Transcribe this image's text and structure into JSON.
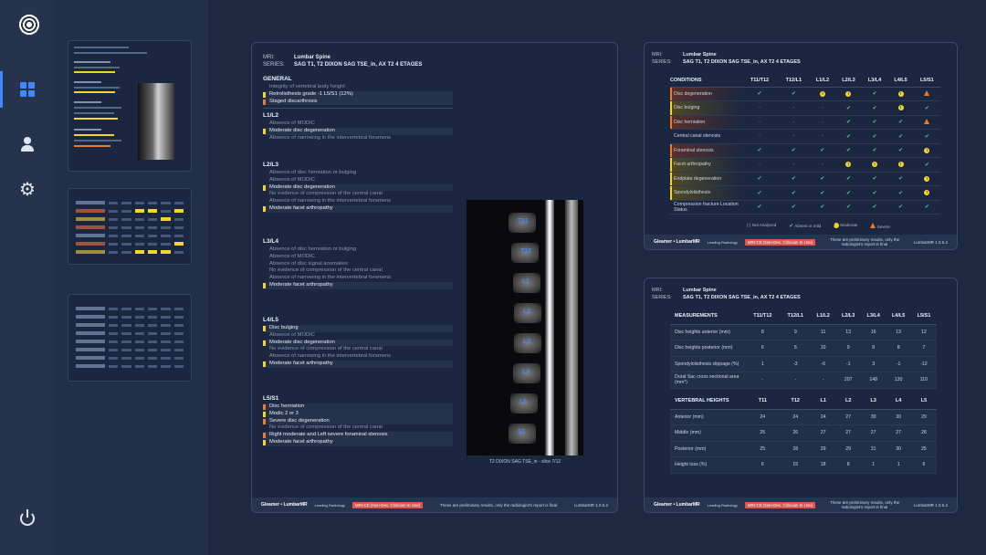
{
  "nav": {
    "items": [
      "dashboard",
      "user",
      "settings",
      "power"
    ]
  },
  "report": {
    "mri_label": "MRI:",
    "mri_value": "Lumbar Spine",
    "series_label": "SERIES:",
    "series_value": "SAG T1, T2 DIXON SAG TSE_in, AX T2 4 ETAGES",
    "image_caption": "T2 DIXON SAG TSE_in - slice 7/12",
    "image_labels": [
      "T11",
      "T12",
      "L1",
      "L2",
      "L3",
      "L4",
      "L5",
      "S1"
    ],
    "sections": [
      {
        "title": "GENERAL",
        "lines": [
          {
            "text": "Integrity of vertebral body height",
            "flag": ""
          },
          {
            "text": "Retrolisthesis grade -1 L5/S1 (12%)",
            "flag": "#f4d52b"
          },
          {
            "text": "Staged discarthrosis",
            "flag": "#f07a2b"
          }
        ]
      },
      {
        "title": "L1/L2",
        "lines": [
          {
            "text": "Absence of MODIC",
            "flag": ""
          },
          {
            "text": "Moderate disc degeneration",
            "flag": "#f4d52b"
          },
          {
            "text": "Absence of narrowing in the intervertebral foramens",
            "flag": ""
          }
        ]
      },
      {
        "title": "L2/L3",
        "lines": [
          {
            "text": "Absence of disc herniation or bulging",
            "flag": ""
          },
          {
            "text": "Absence of MODIC",
            "flag": ""
          },
          {
            "text": "Moderate disc degeneration",
            "flag": "#f4d52b"
          },
          {
            "text": "No evidence of compression of the central canal",
            "flag": ""
          },
          {
            "text": "Absence of narrowing in the intervertebral foramens",
            "flag": ""
          },
          {
            "text": "Moderate facet arthropathy",
            "flag": "#f4d52b"
          }
        ]
      },
      {
        "title": "L3/L4",
        "lines": [
          {
            "text": "Absence of disc herniation or bulging",
            "flag": ""
          },
          {
            "text": "Absence of MODIC",
            "flag": ""
          },
          {
            "text": "Absence of disc signal anomalies",
            "flag": ""
          },
          {
            "text": "No evidence of compression of the central canal",
            "flag": ""
          },
          {
            "text": "Absence of narrowing in the intervertebral foramens",
            "flag": ""
          },
          {
            "text": "Moderate facet arthropathy",
            "flag": "#f4d52b"
          }
        ]
      },
      {
        "title": "L4/L5",
        "lines": [
          {
            "text": "Disc bulging",
            "flag": "#f4d52b"
          },
          {
            "text": "Absence of MODIC",
            "flag": ""
          },
          {
            "text": "Moderate disc degeneration",
            "flag": "#f4d52b"
          },
          {
            "text": "No evidence of compression of the central canal",
            "flag": ""
          },
          {
            "text": "Absence of narrowing in the intervertebral foramens",
            "flag": ""
          },
          {
            "text": "Moderate facet arthropathy",
            "flag": "#f4d52b"
          }
        ]
      },
      {
        "title": "L5/S1",
        "lines": [
          {
            "text": "Disc herniation",
            "flag": "#f07a2b"
          },
          {
            "text": "Modic 2 or 3",
            "flag": "#f4d52b"
          },
          {
            "text": "Severe disc degeneration",
            "flag": "#f07a2b"
          },
          {
            "text": "No evidence of compression of the central canal",
            "flag": ""
          },
          {
            "text": "Right moderate and Left severe foraminal stenosis",
            "flag": "#f07a2b"
          },
          {
            "text": "Moderate facet arthropathy",
            "flag": "#f4d52b"
          }
        ]
      }
    ]
  },
  "footer": {
    "brand": "Gleamer • LumbarMR",
    "partner": "Leading Radiology",
    "warning": "MRI-CE (Non-Dev. Clinician In Use)",
    "note": "These are preliminary results, only the radiologist's report is final",
    "version": "LumbarMR 1.0.6.2"
  },
  "conditions": {
    "columns": [
      "CONDITIONS",
      "T11/T12",
      "T12/L1",
      "L1/L2",
      "L2/L3",
      "L3/L4",
      "L4/L5",
      "L5/S1"
    ],
    "rows": [
      {
        "name": "Disc degeneration",
        "flag": "#f07a2b",
        "bg": "#5b2f2a",
        "cells": [
          "ok",
          "ok",
          "mod",
          "mod",
          "ok",
          "mod",
          "sev"
        ]
      },
      {
        "name": "Disc bulging",
        "flag": "#f4d52b",
        "bg": "#4f4a24",
        "cells": [
          "-",
          "-",
          "-",
          "ok",
          "ok",
          "mod",
          "ok"
        ]
      },
      {
        "name": "Disc herniation",
        "flag": "#f07a2b",
        "bg": "#5b2f2a",
        "cells": [
          "-",
          "-",
          "-",
          "ok",
          "ok",
          "ok",
          "sev"
        ]
      },
      {
        "name": "Central canal stenosis",
        "flag": "",
        "bg": "",
        "cells": [
          "-",
          "-",
          "-",
          "ok",
          "ok",
          "ok",
          "ok"
        ]
      },
      {
        "name": "Foraminal stenosis",
        "flag": "#f07a2b",
        "bg": "#5b2f2a",
        "cells": [
          "ok",
          "ok",
          "ok",
          "ok",
          "ok",
          "ok",
          "mod"
        ]
      },
      {
        "name": "Facet arthropathy",
        "flag": "#f4d52b",
        "bg": "#4f4a24",
        "cells": [
          "-",
          "-",
          "-",
          "mod",
          "mod",
          "mod",
          "ok"
        ]
      },
      {
        "name": "Endplate degeneration",
        "flag": "#f4d52b",
        "bg": "#4f4a24",
        "cells": [
          "ok",
          "ok",
          "ok",
          "ok",
          "ok",
          "ok",
          "mod"
        ]
      },
      {
        "name": "Spondylolisthesis",
        "flag": "#f4d52b",
        "bg": "#4f4a24",
        "cells": [
          "ok",
          "ok",
          "ok",
          "ok",
          "ok",
          "ok",
          "mod"
        ]
      },
      {
        "name": "Compression fracture Location Status",
        "flag": "",
        "bg": "",
        "cells": [
          "ok",
          "ok",
          "ok",
          "ok",
          "ok",
          "ok",
          "ok"
        ]
      }
    ],
    "legend": [
      "(-) Not Analyzed",
      "Absent or mild",
      "Moderate",
      "Severe"
    ]
  },
  "measurements": {
    "columns": [
      "MEASUREMENTS",
      "T11/T12",
      "T12/L1",
      "L1/L2",
      "L2/L3",
      "L3/L4",
      "L4/L5",
      "L5/S1"
    ],
    "rows": [
      {
        "name": "Disc heights anterior (mm)",
        "values": [
          "8",
          "9",
          "11",
          "13",
          "16",
          "13",
          "12"
        ]
      },
      {
        "name": "Disc heights posterior (mm)",
        "values": [
          "6",
          "5",
          "10",
          "9",
          "8",
          "8",
          "7"
        ]
      },
      {
        "name": "Spondylolisthesis slippage (%)",
        "values": [
          "1",
          "-3",
          "-6",
          "-1",
          "3",
          "-1",
          "-12"
        ]
      },
      {
        "name": "Dural Sac cross sectional area (mm²)",
        "values": [
          "-",
          "-",
          "-",
          "207",
          "148",
          "130",
          "110"
        ]
      }
    ],
    "heights_columns": [
      "VERTEBRAL HEIGHTS",
      "T11",
      "T12",
      "L1",
      "L2",
      "L3",
      "L4",
      "L5"
    ],
    "heights_rows": [
      {
        "name": "Anterior (mm)",
        "values": [
          "24",
          "24",
          "24",
          "27",
          "30",
          "30",
          "29"
        ]
      },
      {
        "name": "Middle (mm)",
        "values": [
          "25",
          "26",
          "27",
          "27",
          "27",
          "27",
          "28"
        ]
      },
      {
        "name": "Posterior (mm)",
        "values": [
          "25",
          "28",
          "29",
          "29",
          "31",
          "30",
          "25"
        ]
      },
      {
        "name": "Height loss (%)",
        "values": [
          "6",
          "15",
          "18",
          "8",
          "1",
          "1",
          "6"
        ]
      }
    ]
  }
}
